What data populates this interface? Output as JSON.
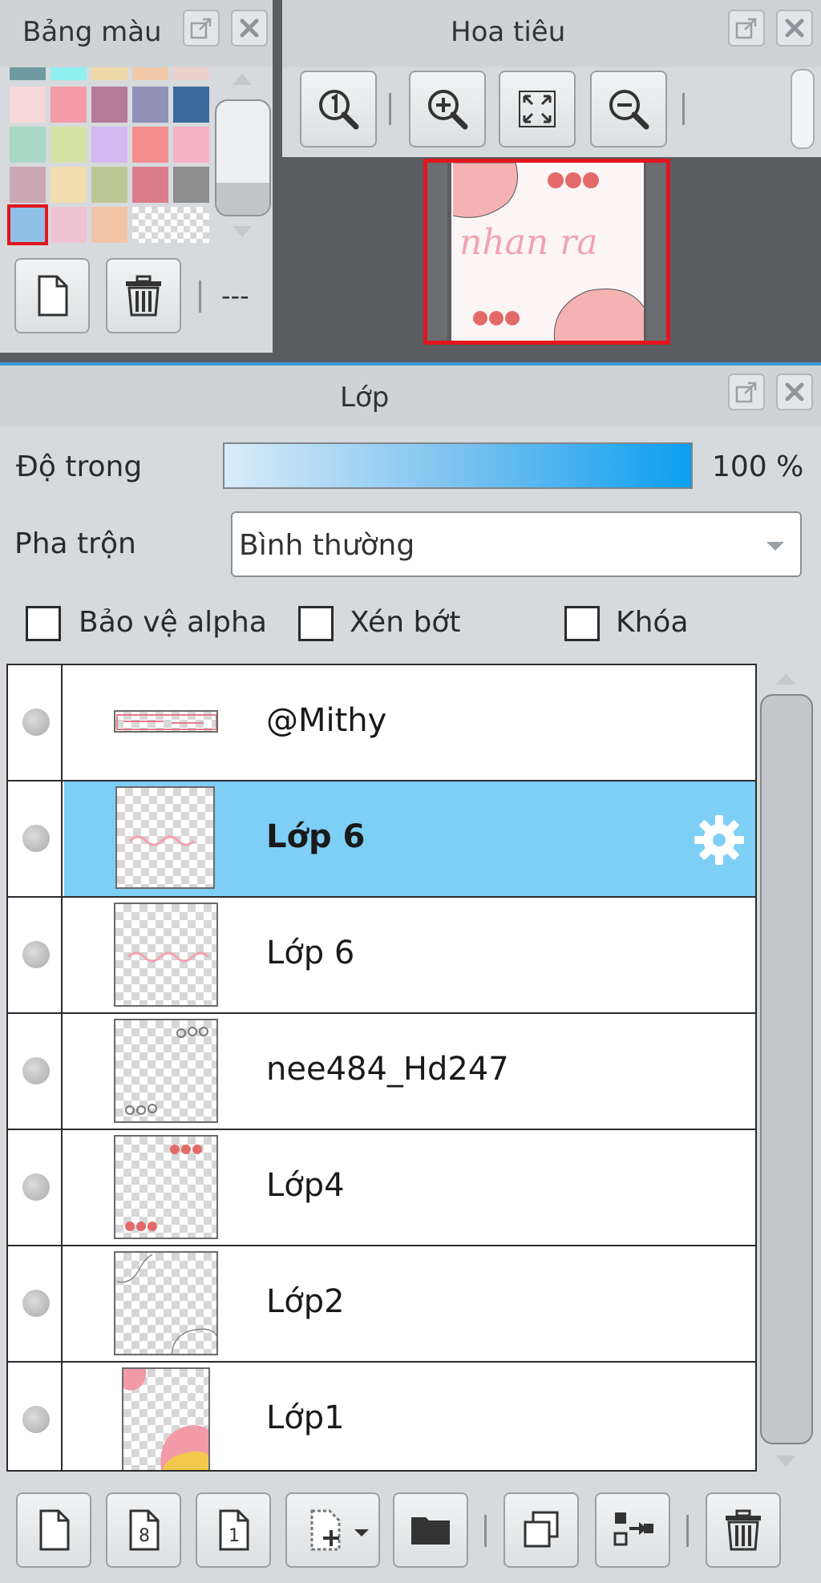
{
  "palette_panel": {
    "title": "Bảng màu",
    "more_label": "---",
    "swatches": [
      [
        "#6f9aa0",
        "#8ff0f0",
        "#efd9a8",
        "#f2c9a9",
        "#ecd0cc"
      ],
      [
        "#f7d8d8",
        "#f59aa8",
        "#b67a9a",
        "#9090b8",
        "#3a6a9e"
      ],
      [
        "#a9d8c6",
        "#d7e3a4",
        "#d4b8f2",
        "#f38e8f",
        "#f6b2c6"
      ],
      [
        "#caa7b2",
        "#f2ddb0",
        "#b9c996",
        "#db7c8d",
        "#8e8e8e"
      ],
      [
        "#8fc0e6",
        "#f0c3d3",
        "#f2c4a6",
        "checker",
        ""
      ]
    ],
    "selected_color": "#8fc0e6"
  },
  "navigator_panel": {
    "title": "Hoa tiêu",
    "preview_text": "nhan ra"
  },
  "layer_panel": {
    "title": "Lớp",
    "opacity_label": "Độ trong",
    "opacity_value": "100 %",
    "blend_label": "Pha trộn",
    "blend_value": "Bình thường",
    "protect_alpha_label": "Bảo vệ alpha",
    "clip_label": "Xén bớt",
    "lock_label": "Khóa",
    "layers": [
      {
        "name": "@Mithy",
        "active": false
      },
      {
        "name": "Lớp 6",
        "active": true
      },
      {
        "name": "Lớp 6",
        "active": false
      },
      {
        "name": "nee484_Hd247",
        "active": false
      },
      {
        "name": "Lớp4",
        "active": false
      },
      {
        "name": "Lớp2",
        "active": false
      },
      {
        "name": "Lớp1",
        "active": false
      }
    ]
  },
  "colors": {
    "selection_red": "#e2161e",
    "active_layer_blue": "#7ecff6",
    "opacity_blue": "#0b9ff0"
  }
}
